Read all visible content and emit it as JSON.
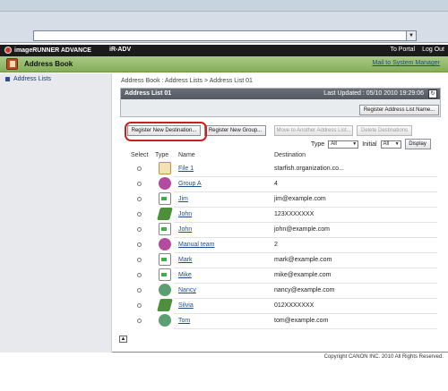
{
  "header": {
    "brand": "imageRUNNER ADVANCE",
    "device": "iR-ADV",
    "links": [
      "To Portal",
      "Log Out"
    ]
  },
  "title": {
    "text": "Address Book",
    "mail_link": "Mail to System Manager"
  },
  "sidebar": {
    "items": [
      {
        "label": "Address Lists"
      }
    ]
  },
  "main": {
    "breadcrumb": "Address Book : Address Lists > Address List 01",
    "panel_title": "Address List 01",
    "last_updated": "Last Updated : 05/10 2010 19:29:06",
    "register_list_button": "Register Address List Name...",
    "actions": [
      {
        "label": "Register New Destination...",
        "enabled": true
      },
      {
        "label": "Register New Group...",
        "enabled": true
      },
      {
        "label": "Move to Another Address List...",
        "enabled": false
      },
      {
        "label": "Delete Destinations",
        "enabled": false
      }
    ],
    "filters": {
      "type_label": "Type",
      "type_value": "All",
      "initial_label": "Initial",
      "initial_value": "All",
      "display_button": "Display"
    },
    "columns": [
      "Select",
      "Type",
      "Name",
      "Destination"
    ],
    "rows": [
      {
        "icon": "file-icon",
        "name": "File 1",
        "destination": "starfish.organization.co..."
      },
      {
        "icon": "group-icon",
        "name": "Group A",
        "destination": "4"
      },
      {
        "icon": "mail-icon",
        "name": "Jim",
        "destination": "jim@example.com"
      },
      {
        "icon": "folder-icon",
        "name": "John",
        "destination": "123XXXXXXX"
      },
      {
        "icon": "mail-icon",
        "name": "John",
        "destination": "john@example.com"
      },
      {
        "icon": "group-icon",
        "name": "Manual team",
        "destination": "2"
      },
      {
        "icon": "mail-icon",
        "name": "Mark",
        "destination": "mark@example.com"
      },
      {
        "icon": "mail-icon",
        "name": "Mike",
        "destination": "mike@example.com"
      },
      {
        "icon": "globe-icon",
        "name": "Nancy",
        "destination": "nancy@example.com"
      },
      {
        "icon": "folder-icon",
        "name": "Silvia",
        "destination": "012XXXXXXX"
      },
      {
        "icon": "globe-icon",
        "name": "Tom",
        "destination": "tom@example.com"
      }
    ]
  },
  "footer": {
    "copyright": "Copyright CANON INC. 2010 All Rights Reserved."
  }
}
